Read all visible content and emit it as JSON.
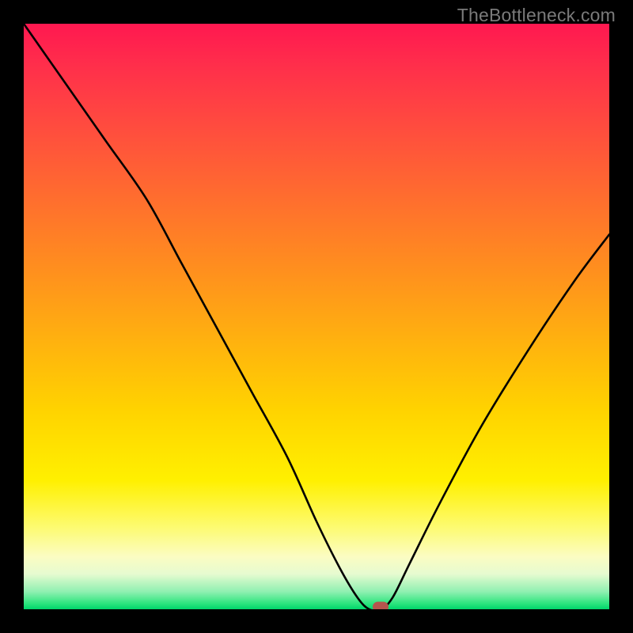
{
  "watermark": "TheBottleneck.com",
  "colors": {
    "frame_bg": "#000000",
    "curve_stroke": "#000000",
    "marker_fill": "#b5554d",
    "watermark_text": "#7a7a7a"
  },
  "chart_data": {
    "type": "line",
    "title": "",
    "xlabel": "",
    "ylabel": "",
    "xlim": [
      0,
      100
    ],
    "ylim": [
      0,
      100
    ],
    "grid": false,
    "legend": false,
    "x": [
      0,
      7,
      14,
      21,
      27,
      33,
      39,
      45,
      50,
      54,
      57,
      59,
      61,
      63,
      66,
      71,
      78,
      86,
      94,
      100
    ],
    "values": [
      100,
      90,
      80,
      70,
      59,
      48,
      37,
      26,
      15,
      7,
      2,
      0,
      0,
      2,
      8,
      18,
      31,
      44,
      56,
      64
    ],
    "marker": {
      "x": 61,
      "y": 0
    },
    "gradient_stops": [
      {
        "pos": 0.0,
        "color": "#ff1850"
      },
      {
        "pos": 0.07,
        "color": "#ff2e4b"
      },
      {
        "pos": 0.18,
        "color": "#ff4d3e"
      },
      {
        "pos": 0.3,
        "color": "#ff6e2e"
      },
      {
        "pos": 0.42,
        "color": "#ff8f1e"
      },
      {
        "pos": 0.54,
        "color": "#ffb10f"
      },
      {
        "pos": 0.66,
        "color": "#ffd300"
      },
      {
        "pos": 0.78,
        "color": "#fff000"
      },
      {
        "pos": 0.86,
        "color": "#fdfb71"
      },
      {
        "pos": 0.91,
        "color": "#fbfcc2"
      },
      {
        "pos": 0.94,
        "color": "#e6fbd0"
      },
      {
        "pos": 0.97,
        "color": "#8ff0b1"
      },
      {
        "pos": 0.99,
        "color": "#2de57e"
      },
      {
        "pos": 1.0,
        "color": "#00d66a"
      }
    ]
  }
}
